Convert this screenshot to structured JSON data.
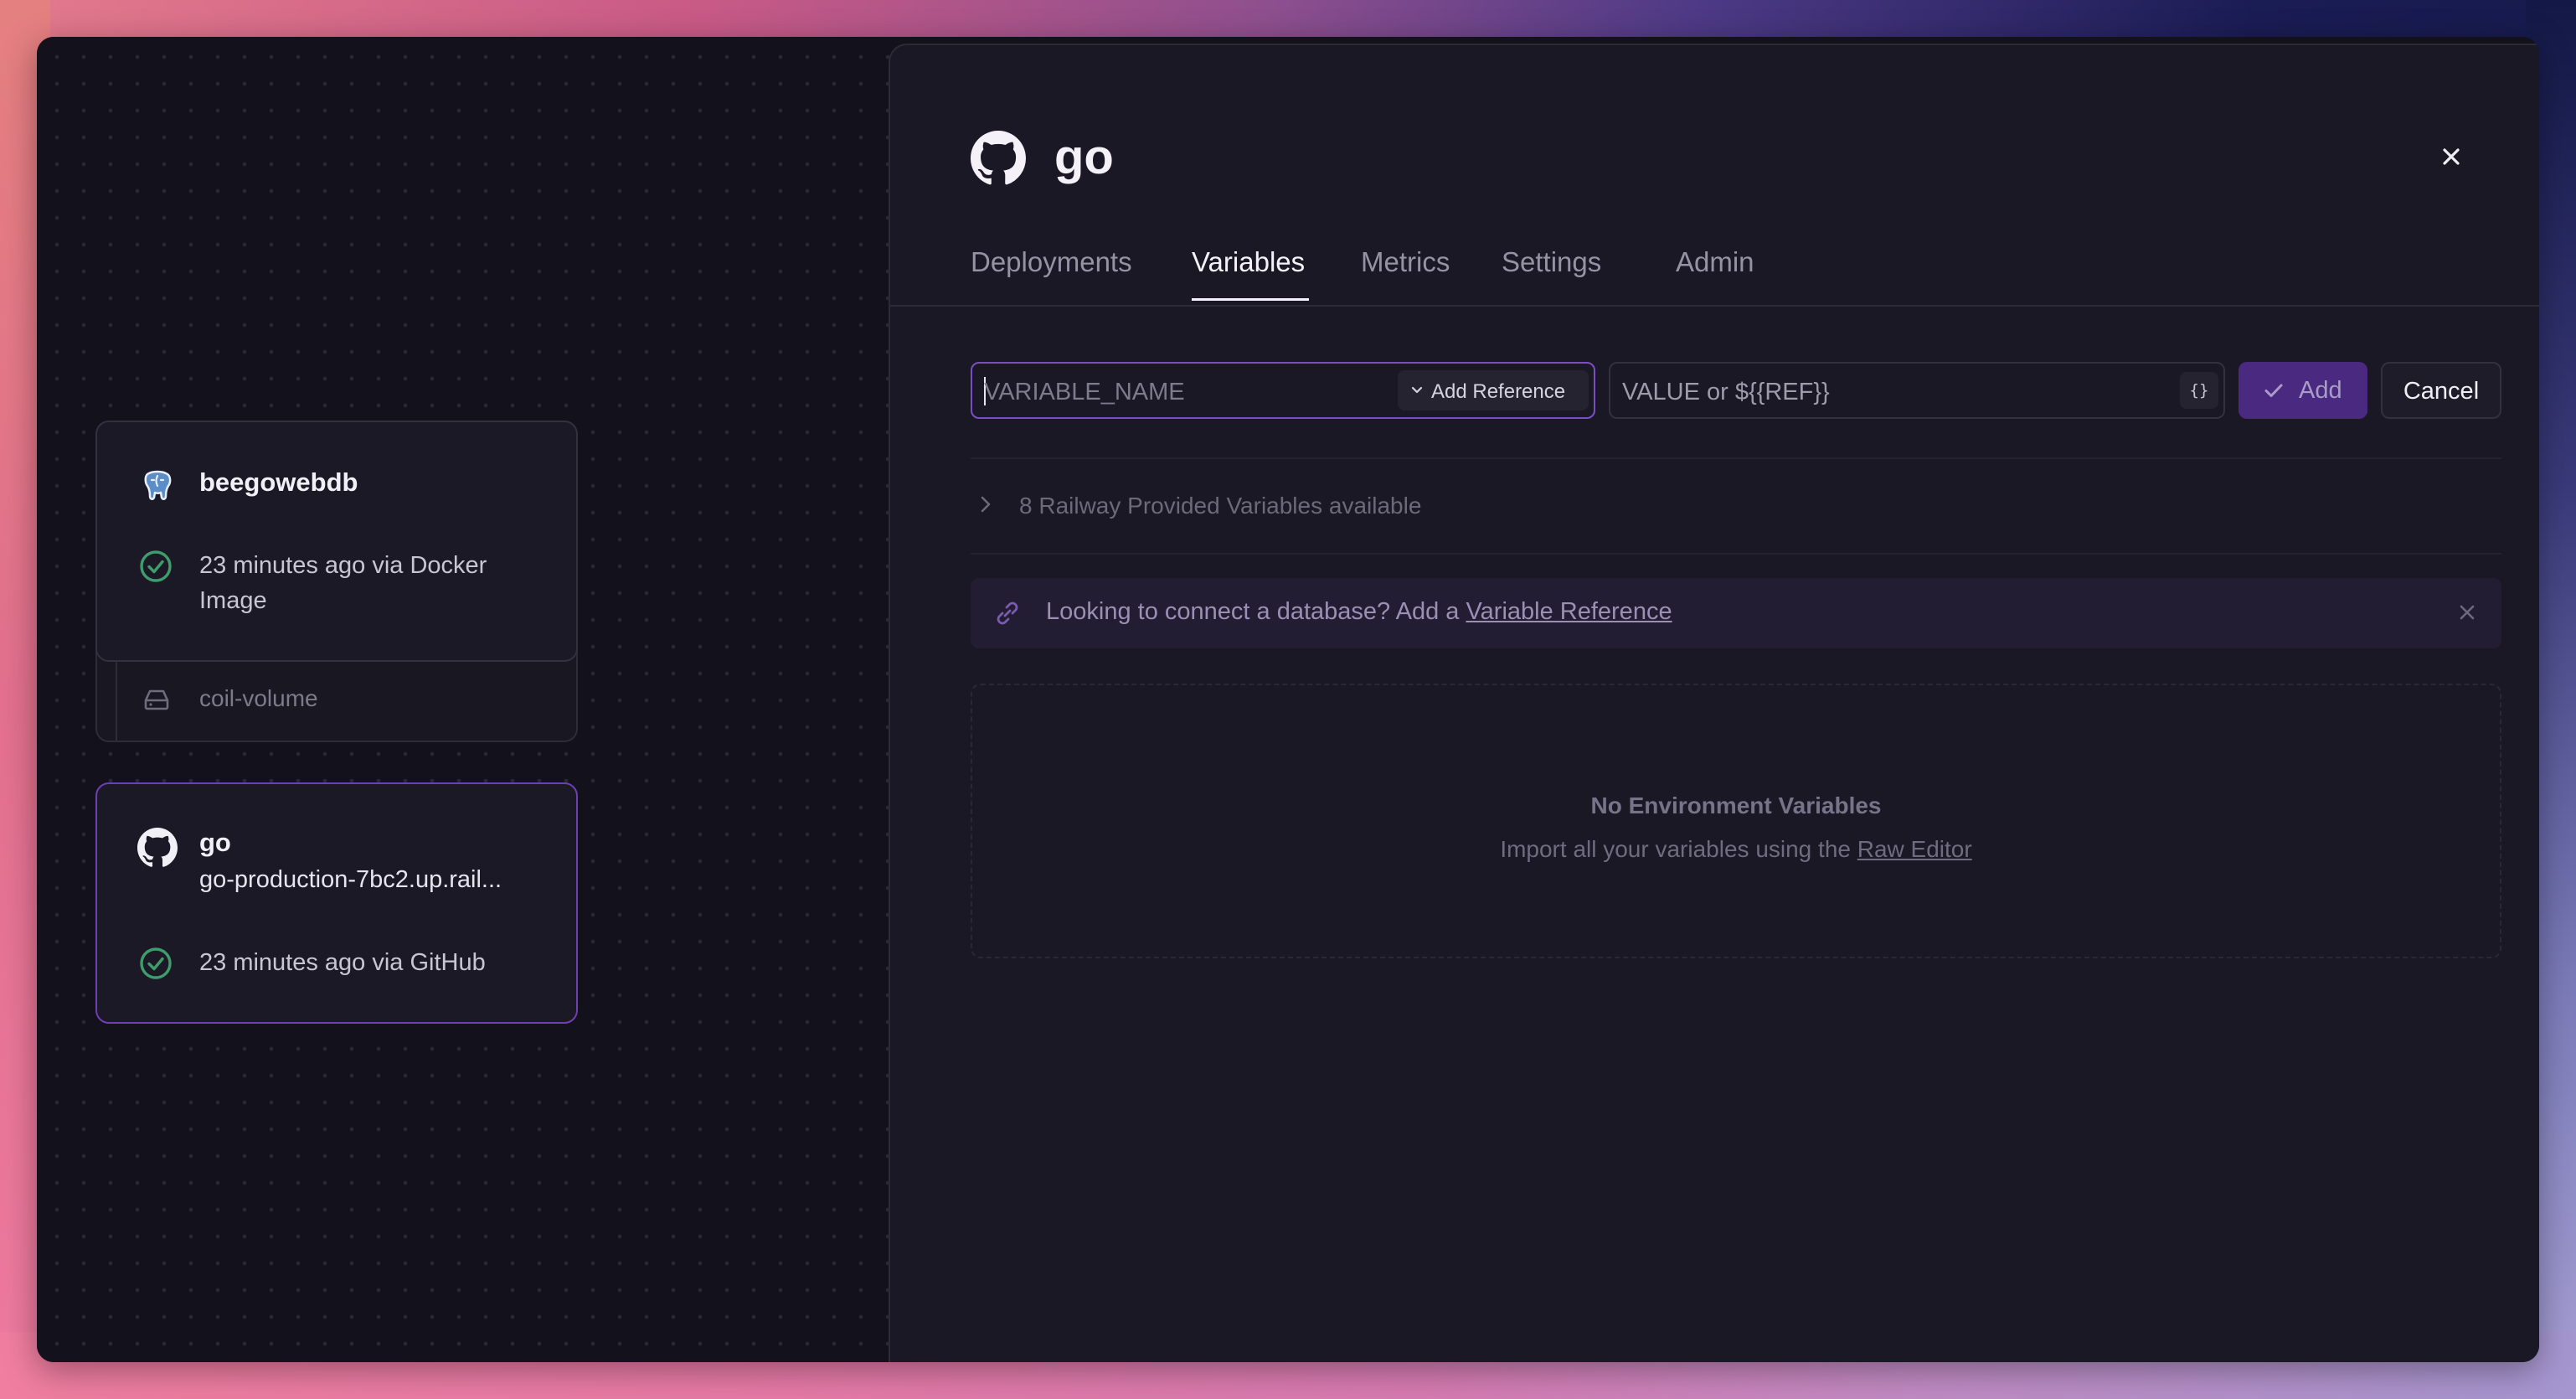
{
  "canvas": {
    "services": [
      {
        "name": "beegowebdb",
        "icon": "postgres-elephant-icon",
        "status_text": "23 minutes ago via Docker Image",
        "volume_label": "coil-volume"
      },
      {
        "name": "go",
        "icon": "github-icon",
        "url": "go-production-7bc2.up.rail...",
        "status_text": "23 minutes ago via GitHub"
      }
    ]
  },
  "panel": {
    "title": "go",
    "tabs": [
      {
        "label": "Deployments",
        "active": false
      },
      {
        "label": "Variables",
        "active": true
      },
      {
        "label": "Metrics",
        "active": false
      },
      {
        "label": "Settings",
        "active": false
      },
      {
        "label": "Admin",
        "active": false
      }
    ],
    "new_variable": {
      "name_placeholder": "VARIABLE_NAME",
      "add_reference_label": "Add Reference",
      "value_placeholder": "VALUE or ${{REF}}",
      "brace_label": "{}",
      "add_label": "Add",
      "cancel_label": "Cancel"
    },
    "provided_vars_label": "8 Railway Provided Variables available",
    "banner": {
      "text": "Looking to connect a database? Add a ",
      "link": "Variable Reference"
    },
    "empty_state": {
      "heading": "No Environment Variables",
      "text": "Import all your variables using the ",
      "link": "Raw Editor"
    }
  },
  "colors": {
    "accent": "#6e3fb3",
    "success": "#3f9c6d",
    "panel_bg": "#1a1824",
    "canvas_bg": "#13111c"
  }
}
